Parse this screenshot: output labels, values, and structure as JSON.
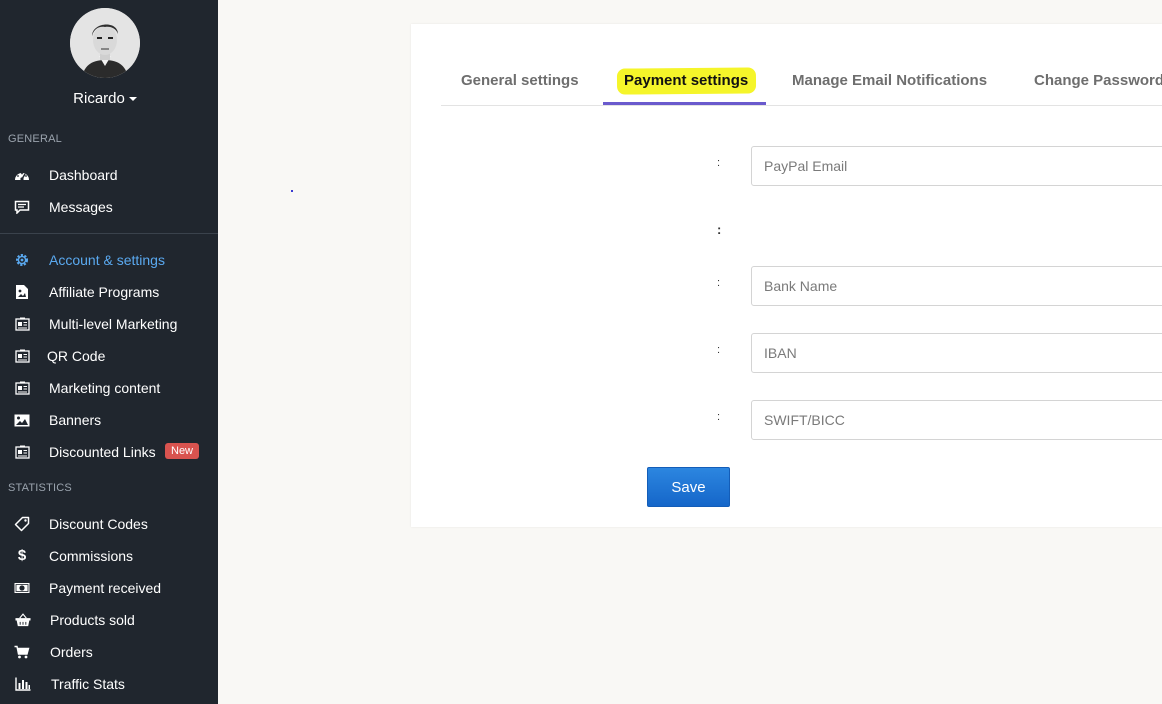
{
  "profile": {
    "username": "Ricardo"
  },
  "sidebar": {
    "section_general": "GENERAL",
    "section_statistics": "STATISTICS",
    "general_items": [
      {
        "label": "Dashboard",
        "icon": "dashboard-icon"
      },
      {
        "label": "Messages",
        "icon": "messages-icon"
      }
    ],
    "account_items": [
      {
        "label": "Account & settings",
        "icon": "gear-icon",
        "active": true
      },
      {
        "label": "Affiliate Programs",
        "icon": "document-image-icon"
      },
      {
        "label": "Multi-level Marketing",
        "icon": "id-card-icon"
      },
      {
        "label": "QR Code",
        "icon": "id-card-icon"
      },
      {
        "label": "Marketing content",
        "icon": "id-card-icon"
      },
      {
        "label": "Banners",
        "icon": "image-icon"
      },
      {
        "label": "Discounted Links",
        "icon": "id-card-icon",
        "badge": "New"
      }
    ],
    "statistics_items": [
      {
        "label": "Discount Codes",
        "icon": "tag-icon"
      },
      {
        "label": "Commissions",
        "icon": "dollar-icon"
      },
      {
        "label": "Payment received",
        "icon": "money-icon"
      },
      {
        "label": "Products sold",
        "icon": "basket-icon"
      },
      {
        "label": "Orders",
        "icon": "cart-icon"
      },
      {
        "label": "Traffic Stats",
        "icon": "bar-chart-icon"
      }
    ]
  },
  "tabs": [
    {
      "label": "General settings"
    },
    {
      "label": "Payment settings",
      "active": true
    },
    {
      "label": "Manage Email Notifications"
    },
    {
      "label": "Change Password"
    }
  ],
  "form": {
    "colon": ":",
    "paypal_placeholder": "PayPal Email",
    "bank_name_placeholder": "Bank Name",
    "iban_placeholder": "IBAN",
    "swift_placeholder": "SWIFT/BICC",
    "save_label": "Save"
  },
  "colors": {
    "sidebar_bg": "#20262e",
    "active_link": "#5aa9f0",
    "tab_underline": "#6a5acd",
    "highlight": "#f5f52a",
    "primary_button": "#1f77d6",
    "badge": "#d9534f"
  }
}
